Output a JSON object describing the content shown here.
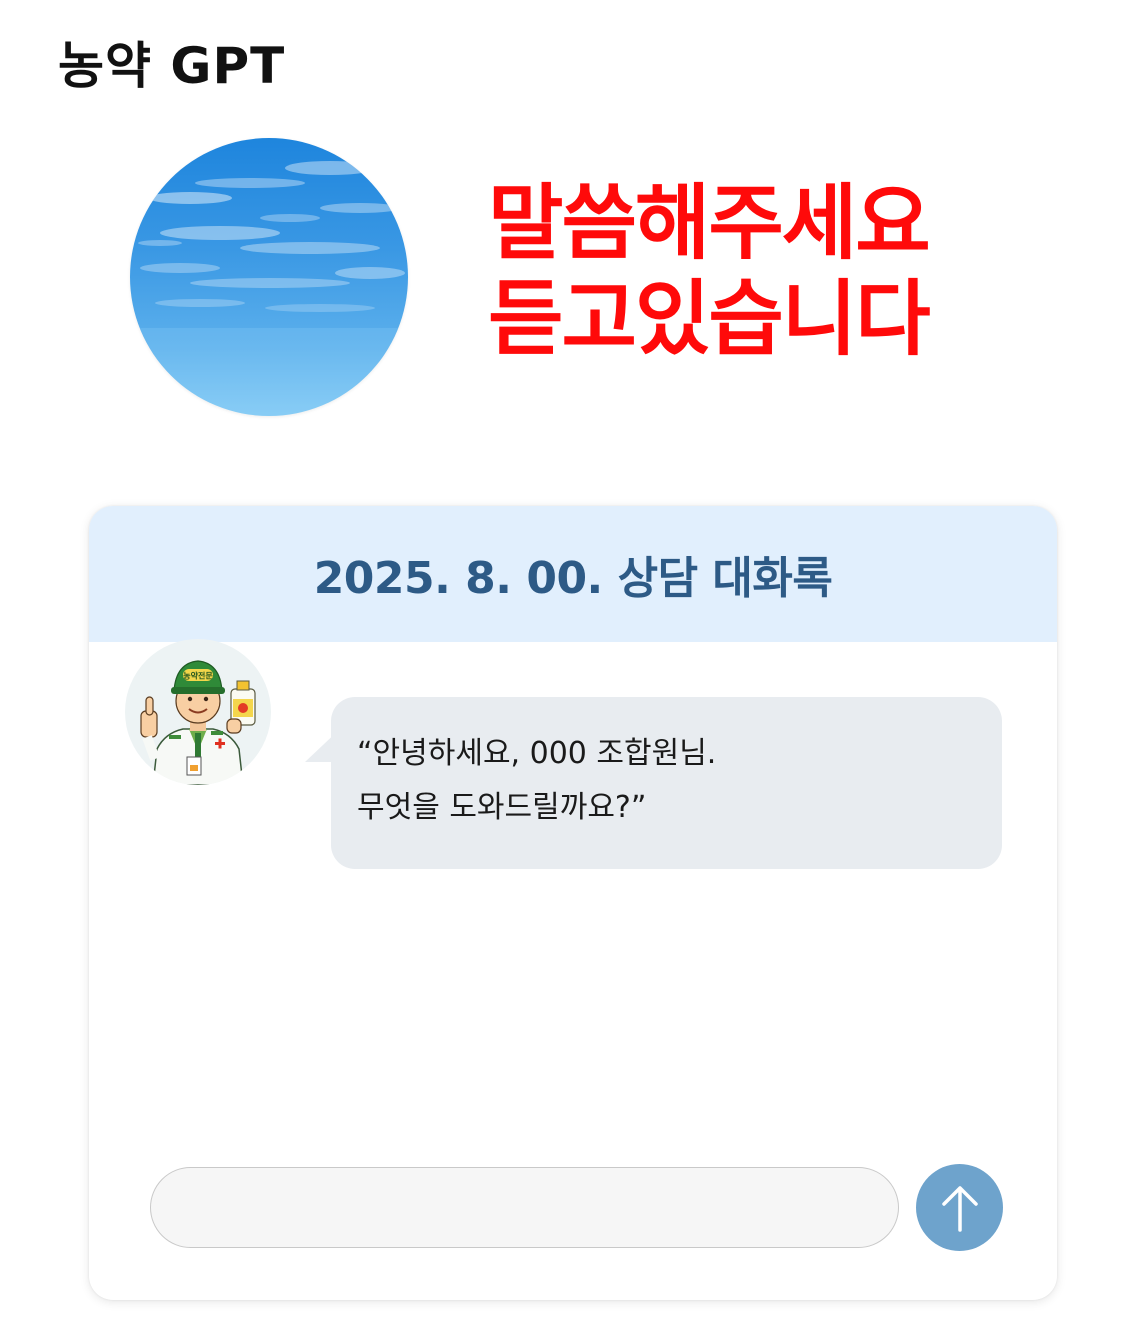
{
  "app": {
    "title": "농약 GPT"
  },
  "hero": {
    "line1": "말씀해주세요",
    "line2": "듣고있습니다"
  },
  "chat": {
    "header_title": "2025. 8. 00. 상담 대화록",
    "messages": [
      {
        "sender": "assistant",
        "lines": [
          "“안녕하세요, 000 조합원님.",
          "무엇을 도와드릴까요?”"
        ]
      }
    ],
    "avatar_badge": "농약전문",
    "input": {
      "value": "",
      "placeholder": ""
    }
  },
  "icons": {
    "orb": "sky-orb-icon",
    "avatar": "pesticide-expert-avatar-icon",
    "send": "arrow-up-icon"
  },
  "colors": {
    "hero_text": "#ff0a0a",
    "header_bg": "#e1effd",
    "header_text": "#2d5a86",
    "bubble_bg": "#e8ecf0",
    "send_button": "#6ea3cc"
  }
}
